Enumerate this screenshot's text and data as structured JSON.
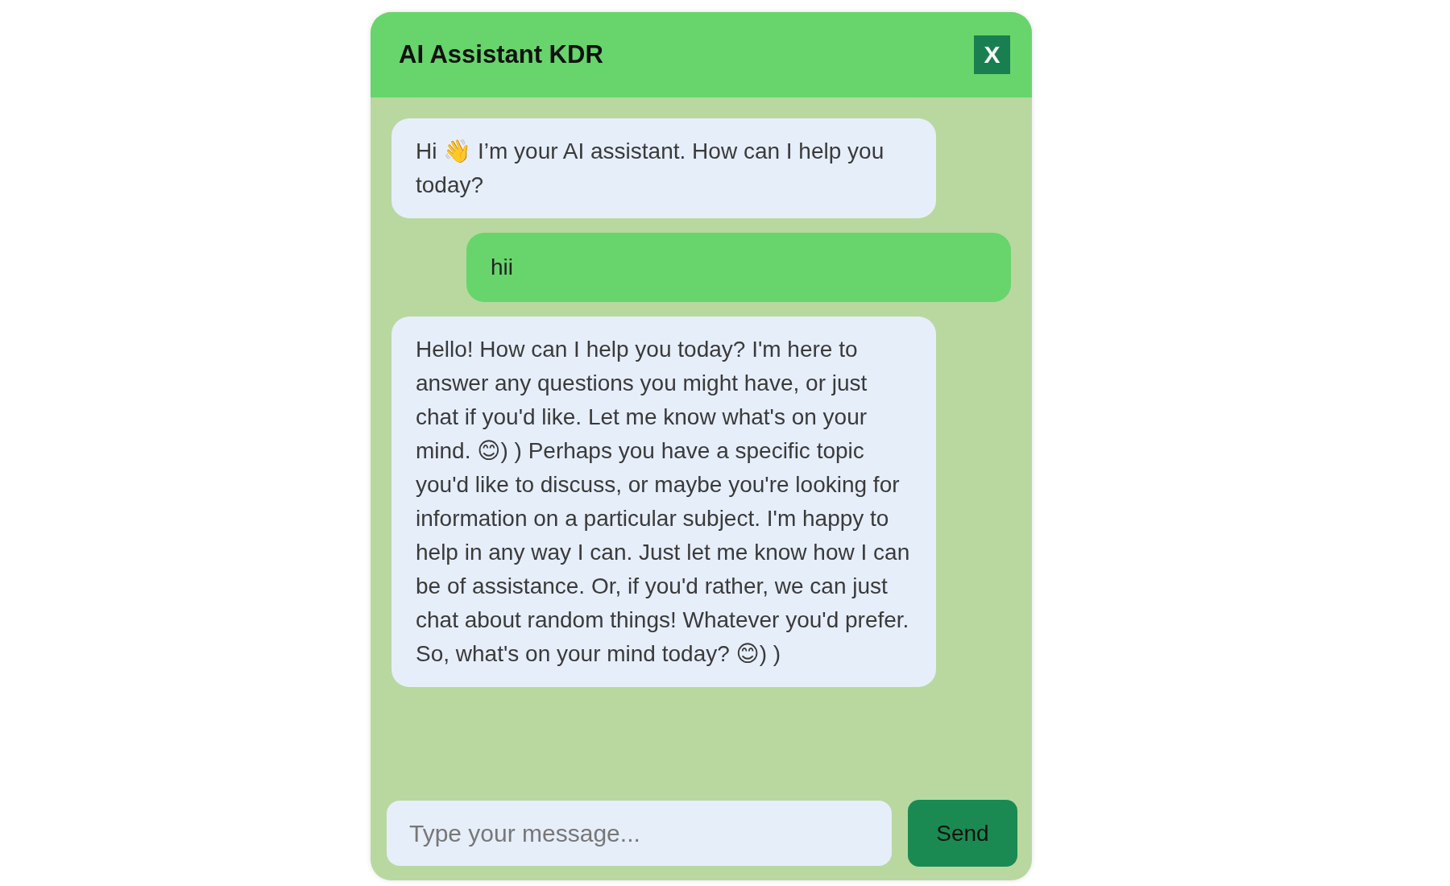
{
  "window": {
    "title": "AI Assistant KDR",
    "close": "X"
  },
  "messages": [
    {
      "kind": "bot",
      "text": "Hi 👋 I’m your AI assistant. How can I help you today?"
    },
    {
      "kind": "user",
      "text": "hii"
    },
    {
      "kind": "bot",
      "text": "Hello! How can I help you today? I'm here to answer any questions you might have, or just chat if you'd like. Let me know what's on your mind. 😊) ) Perhaps you have a specific topic you'd like to discuss, or maybe you're looking for information on a particular subject. I'm happy to help in any way I can. Just let me know how I can be of assistance. Or, if you'd rather, we can just chat about random things! Whatever you'd prefer. So, what's on your mind today? 😊) )"
    }
  ],
  "composer": {
    "placeholder": "Type your message...",
    "send": "Send"
  }
}
